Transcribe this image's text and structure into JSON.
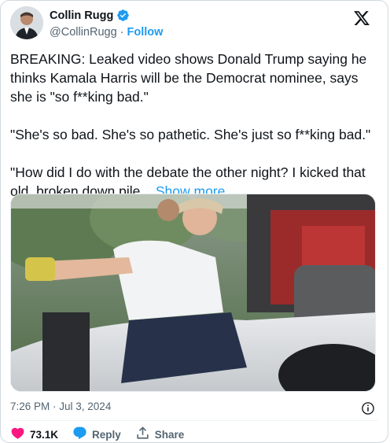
{
  "author": {
    "name": "Collin Rugg",
    "handle": "@CollinRugg",
    "separator": "·",
    "follow_label": "Follow"
  },
  "tweet": {
    "paragraphs": [
      "BREAKING: Leaked video shows Donald Trump saying he thinks Kamala Harris will be the Democrat nominee, says she is \"so f**king bad.\"",
      "\"She's so bad. She's so pathetic. She's just so f**king bad.\"",
      "\"How did I do with the debate the other night? I kicked that old, broken down pile..."
    ],
    "show_more_label": "Show more"
  },
  "timestamp": "7:26 PM · Jul 3, 2024",
  "actions": {
    "likes": "73.1K",
    "reply_label": "Reply",
    "share_label": "Share"
  },
  "colors": {
    "accent": "#1d9bf0",
    "like": "#f91880",
    "text": "#0f1419",
    "muted": "#536471"
  }
}
